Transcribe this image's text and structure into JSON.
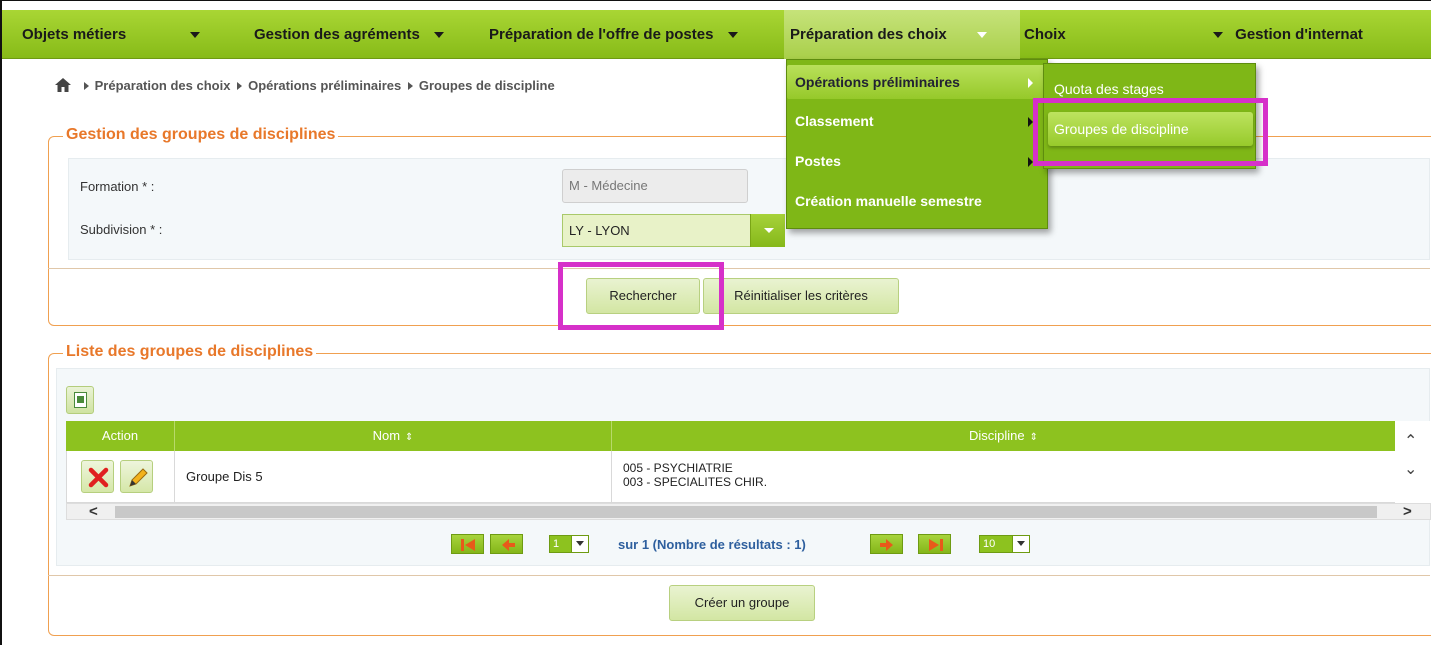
{
  "nav": {
    "items": [
      {
        "label": "Objets métiers"
      },
      {
        "label": "Gestion des agréments"
      },
      {
        "label": "Préparation de l'offre de postes"
      },
      {
        "label": "Préparation des choix"
      },
      {
        "label": "Choix"
      },
      {
        "label": "Gestion d'internat"
      }
    ]
  },
  "breadcrumb": {
    "items": [
      "Préparation des choix",
      "Opérations préliminaires",
      "Groupes de discipline"
    ]
  },
  "search_panel": {
    "title": "Gestion des groupes de disciplines",
    "formation_label": "Formation  *  :",
    "formation_value": "M - Médecine",
    "subdivision_label": "Subdivision  *  :",
    "subdivision_value": "LY - LYON",
    "search_button": "Rechercher",
    "reset_button": "Réinitialiser les critères"
  },
  "list_panel": {
    "title": "Liste des groupes de disciplines",
    "columns": {
      "action": "Action",
      "nom": "Nom",
      "discipline": "Discipline"
    },
    "rows": [
      {
        "nom": "Groupe Dis 5",
        "discipline_1": "005 - PSYCHIATRIE",
        "discipline_2": "003 - SPECIALITES CHIR."
      }
    ],
    "pager": {
      "page": "1",
      "info": "sur 1 (Nombre de résultats : 1)",
      "page_size": "10"
    },
    "create_button": "Créer un groupe"
  },
  "menu": {
    "level1": [
      {
        "label": "Opérations préliminaires"
      },
      {
        "label": "Classement"
      },
      {
        "label": "Postes"
      },
      {
        "label": "Création manuelle semestre"
      }
    ],
    "level2": [
      {
        "label": "Quota des stages"
      },
      {
        "label": "Groupes de discipline"
      }
    ]
  },
  "colors": {
    "accent_green": "#8dc21f",
    "title_orange": "#e8782a",
    "highlight_magenta": "#d630c9"
  }
}
